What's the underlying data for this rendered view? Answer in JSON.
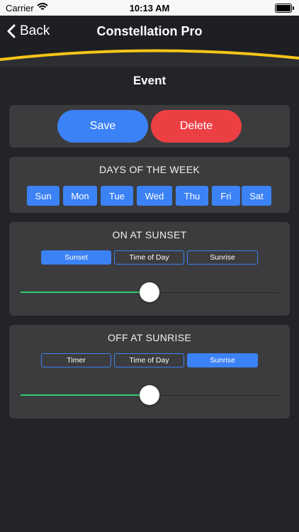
{
  "status": {
    "carrier": "Carrier",
    "time": "10:13 AM"
  },
  "nav": {
    "back_label": "Back",
    "title": "Constellation Pro"
  },
  "page": {
    "title": "Event"
  },
  "actions": {
    "save_label": "Save",
    "delete_label": "Delete"
  },
  "days": {
    "title": "DAYS OF THE WEEK",
    "items": [
      "Sun",
      "Mon",
      "Tue",
      "Wed",
      "Thu",
      "Fri",
      "Sat"
    ]
  },
  "on_section": {
    "title": "ON AT SUNSET",
    "options": [
      "Sunset",
      "Time of Day",
      "Sunrise"
    ],
    "selected": "Sunset",
    "slider_value": 0.5
  },
  "off_section": {
    "title": "OFF AT SUNRISE",
    "options": [
      "Timer",
      "Time of Day",
      "Sunrise"
    ],
    "selected": "Sunrise",
    "slider_value": 0.5
  },
  "colors": {
    "accent": "#3b82f6",
    "danger": "#ec3f44",
    "slider_fill": "#2ecc71",
    "swoosh": "#f5c518"
  }
}
